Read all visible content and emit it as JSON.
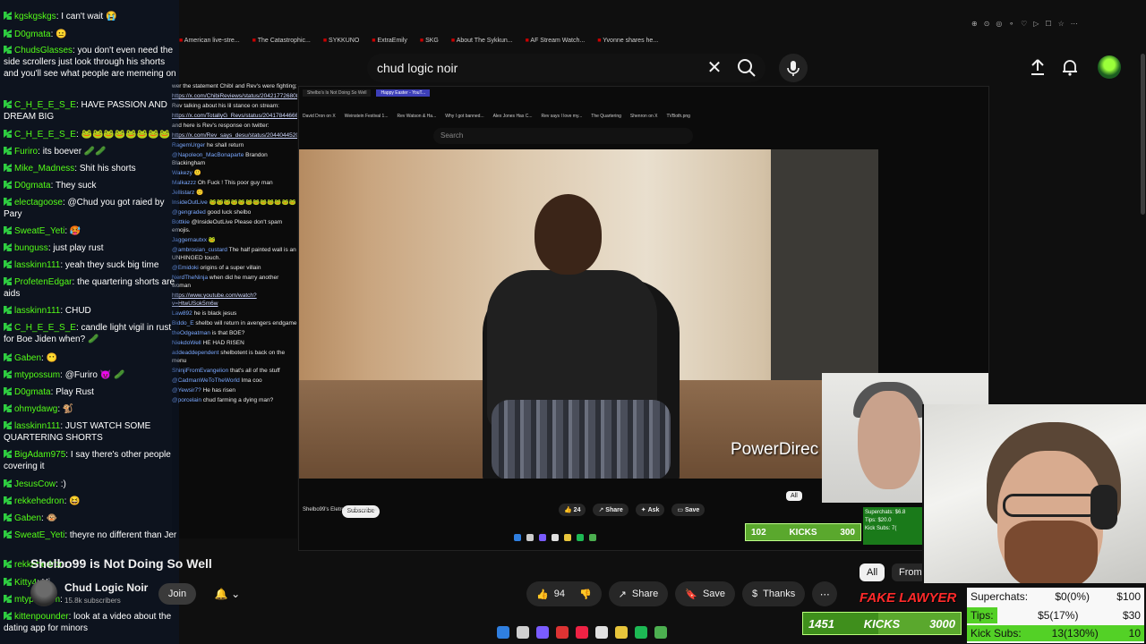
{
  "browser": {
    "bookmarks": [
      "American live-stre...",
      "The Catastrophic...",
      "SYKKUNO",
      "ExtraEmily",
      "SKG",
      "About The Sykkun...",
      "AF Stream Watch...",
      "Yvonne shares he..."
    ]
  },
  "header": {
    "search_query": "chud logic noir",
    "search_icon": "search-icon",
    "mic_icon": "mic-icon",
    "upload_icon": "upload-icon",
    "bell_icon": "bell-icon"
  },
  "inner_window": {
    "tabs": [
      "Shelbo's Is Not Doing So Well",
      "Happy Easter - YouT..."
    ],
    "bookmarks": [
      "David Dron on X",
      "Weinstein Festival 1...",
      "Rev Watson & Ha...",
      "Why I got banned...",
      "Alex Jones Has C...",
      "Rev says I love my...",
      "The Quartering",
      "Shenron on X",
      "TVBoth.png"
    ],
    "search_placeholder": "Search",
    "watermark": "PowerDirec",
    "channel_label": "Shelbo99's Eletronic Showcase",
    "subscribe_label": "Subscribe",
    "like_count": "24",
    "share_label": "Share",
    "ask_label": "Ask",
    "save_label": "Save",
    "chip_all": "All",
    "kicks_count": "102",
    "kicks_label": "KICKS",
    "kicks_goal": "300",
    "stats_lines": [
      "Superchats: $6.8",
      "Tips: $20.0",
      "Kick Subs: 7("
    ]
  },
  "chat": [
    {
      "user": "kgskgskgs",
      "text": "I can't wait 😭"
    },
    {
      "user": "D0gmata",
      "text": "😐"
    },
    {
      "user": "ChudsGlasses",
      "text": "you don't even need the side scrollers just look through his shorts and you'll see what people are memeing on"
    },
    {
      "user": "C_H_E_E_S_E",
      "text": "HAVE PASSION AND DREAM BIG"
    },
    {
      "user": "C_H_E_E_S_E",
      "text": "🐸🐸🐸🐸🐸🐸🐸🐸"
    },
    {
      "user": "Furiro",
      "text": "its boever 🥒🥒"
    },
    {
      "user": "Mike_Madness",
      "text": "Shit his shorts"
    },
    {
      "user": "D0gmata",
      "text": "They suck"
    },
    {
      "user": "electagoose",
      "text": "@Chud you got raied by Pary"
    },
    {
      "user": "SweatE_Yeti",
      "text": "🥵"
    },
    {
      "user": "bunguss",
      "text": "just play rust"
    },
    {
      "user": "lasskinn111",
      "text": "yeah they suck big time"
    },
    {
      "user": "ProfetenEdgar",
      "text": "the quartering shorts are aids"
    },
    {
      "user": "lasskinn111",
      "text": "CHUD"
    },
    {
      "user": "C_H_E_E_S_E",
      "text": "candle light vigil in rust for Boe Jiden when? 🥒"
    },
    {
      "user": "Gaben",
      "text": "😶"
    },
    {
      "user": "mtypossum",
      "text": "@Furiro 😈 🥒"
    },
    {
      "user": "D0gmata",
      "text": "Play Rust"
    },
    {
      "user": "ohmydawg",
      "text": "🐒"
    },
    {
      "user": "lasskinn111",
      "text": "JUST WATCH SOME QUARTERING SHORTS"
    },
    {
      "user": "BigAdam975",
      "text": "I say there's other people covering it"
    },
    {
      "user": "JesusCow",
      "text": ":)"
    },
    {
      "user": "rekkehedron",
      "text": "😆"
    },
    {
      "user": "Gaben",
      "text": "🐵"
    },
    {
      "user": "SweatE_Yeti",
      "text": "theyre no different than Jer"
    },
    {
      "user": "rekkehedron",
      "text": ""
    },
    {
      "user": "Kitty4",
      "text": "Hi"
    },
    {
      "user": "mtypossum",
      "text": ""
    },
    {
      "user": "kittenpounder",
      "text": "look at a video about the dating app for minors"
    }
  ],
  "chat2": [
    {
      "user": "",
      "text": "wer the statement ChibI and Rev's were fighting;"
    },
    {
      "user": "",
      "text": "https://x.com/ChibiReviews/status/2042177268084050700",
      "link": true
    },
    {
      "user": "",
      "text": "Rev talking about his lil stance on stream:"
    },
    {
      "user": "",
      "text": "https://x.com/TotallyG_Revs/status/204178446665908005",
      "link": true
    },
    {
      "user": "",
      "text": "and here is Rev's response on twitter:"
    },
    {
      "user": "",
      "text": "https://x.com/Rev_says_desu/status/204404452021660812",
      "link": true
    },
    {
      "user": "RagemUrger",
      "text": "he shall return"
    },
    {
      "user": "@Napoleon_MacBonaparte",
      "text": "Brandon Blackingham"
    },
    {
      "user": "Wakezy",
      "text": "🙂"
    },
    {
      "user": "Malkazzz",
      "text": "Oh Fuck ! This poor guy man"
    },
    {
      "user": "Jellistarz",
      "text": "🙂"
    },
    {
      "user": "InsideOutLive",
      "text": "🐸🐸🐸🐸🐸🐸🐸🐸🐸🐸🐸🐸"
    },
    {
      "user": "@gengraded",
      "text": "good luck shelbo"
    },
    {
      "user": "Bottkie",
      "text": "@InsideOutLive Please don't spam emojis."
    },
    {
      "user": "Jaggernautxx",
      "text": "🐸"
    },
    {
      "user": "@ambrosian_custard",
      "text": "The half painted wall is an UNHINGED touch."
    },
    {
      "user": "@Emidoki",
      "text": "origins of a super villain"
    },
    {
      "user": "NerdTheNinja",
      "text": "when did he marry another woman"
    },
    {
      "user": "",
      "text": "https://www.youtube.com/watch?v=HtwUSok5m6w",
      "link": true
    },
    {
      "user": "Law892",
      "text": "he is black jesus"
    },
    {
      "user": "Biddo_E",
      "text": "shelbo will return in avengers endgame"
    },
    {
      "user": "theOdgeatman",
      "text": "is that BOE?"
    },
    {
      "user": "NiekdoWell",
      "text": "HE HAD RISEN"
    },
    {
      "user": "addeaddependent",
      "text": "shelbotent is back on the menu"
    },
    {
      "user": "ShinjiFromEvangelion",
      "text": "that's all of the stuff"
    },
    {
      "user": "@CadmanWeToTheWorld",
      "text": "Ima coo"
    },
    {
      "user": "@Yewsir7?",
      "text": "He has risen"
    },
    {
      "user": "@porcelain",
      "text": "chud farming a dying man?"
    }
  ],
  "video": {
    "title": "Shelbo99 is Not Doing So Well",
    "channel": "Chud Logic Noir",
    "subscribers": "15.8k subscribers",
    "join_label": "Join",
    "like_count": "94",
    "share_label": "Share",
    "save_label": "Save",
    "thanks_label": "Thanks",
    "chip_all": "All",
    "chip_from": "From"
  },
  "overlay": {
    "fake_lawyer": "FAKE LAWYER",
    "kicks_count": "1451",
    "kicks_label": "KICKS",
    "kicks_goal": "3000",
    "kicks_progress": 0.48,
    "stats": [
      {
        "label": "Superchats:",
        "value": "$0(0%)",
        "goal": "$100",
        "progress": 0.0
      },
      {
        "label": "Tips:",
        "value": "$5(17%)",
        "goal": "$30",
        "progress": 0.17
      },
      {
        "label": "Kick Subs:",
        "value": "13(130%)",
        "goal": "10",
        "progress": 1.0
      }
    ],
    "colors": {
      "kick_green": "#53fc18",
      "bar_green": "#5aa82d",
      "lawyer_red": "#ff2a2a"
    }
  },
  "taskbar": {
    "icons": [
      "windows-icon",
      "search-icon",
      "discord-icon",
      "obs-icon",
      "chrome-icon",
      "app-icon",
      "folder-icon",
      "spotify-icon",
      "xbox-icon"
    ]
  }
}
